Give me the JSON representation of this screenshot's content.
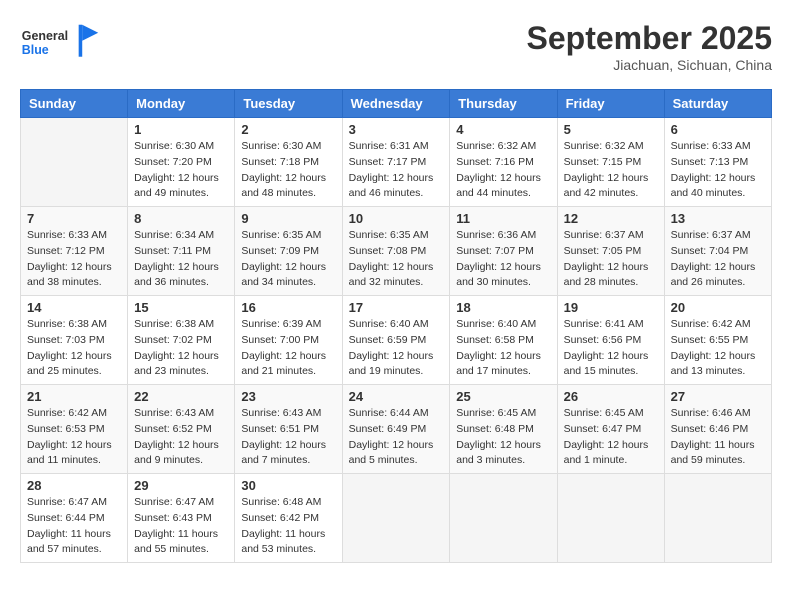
{
  "header": {
    "logo_general": "General",
    "logo_blue": "Blue",
    "month_title": "September 2025",
    "location": "Jiachuan, Sichuan, China"
  },
  "days_of_week": [
    "Sunday",
    "Monday",
    "Tuesday",
    "Wednesday",
    "Thursday",
    "Friday",
    "Saturday"
  ],
  "weeks": [
    [
      {
        "day": "",
        "empty": true
      },
      {
        "day": "1",
        "sunrise": "Sunrise: 6:30 AM",
        "sunset": "Sunset: 7:20 PM",
        "daylight": "Daylight: 12 hours and 49 minutes."
      },
      {
        "day": "2",
        "sunrise": "Sunrise: 6:30 AM",
        "sunset": "Sunset: 7:18 PM",
        "daylight": "Daylight: 12 hours and 48 minutes."
      },
      {
        "day": "3",
        "sunrise": "Sunrise: 6:31 AM",
        "sunset": "Sunset: 7:17 PM",
        "daylight": "Daylight: 12 hours and 46 minutes."
      },
      {
        "day": "4",
        "sunrise": "Sunrise: 6:32 AM",
        "sunset": "Sunset: 7:16 PM",
        "daylight": "Daylight: 12 hours and 44 minutes."
      },
      {
        "day": "5",
        "sunrise": "Sunrise: 6:32 AM",
        "sunset": "Sunset: 7:15 PM",
        "daylight": "Daylight: 12 hours and 42 minutes."
      },
      {
        "day": "6",
        "sunrise": "Sunrise: 6:33 AM",
        "sunset": "Sunset: 7:13 PM",
        "daylight": "Daylight: 12 hours and 40 minutes."
      }
    ],
    [
      {
        "day": "7",
        "sunrise": "Sunrise: 6:33 AM",
        "sunset": "Sunset: 7:12 PM",
        "daylight": "Daylight: 12 hours and 38 minutes."
      },
      {
        "day": "8",
        "sunrise": "Sunrise: 6:34 AM",
        "sunset": "Sunset: 7:11 PM",
        "daylight": "Daylight: 12 hours and 36 minutes."
      },
      {
        "day": "9",
        "sunrise": "Sunrise: 6:35 AM",
        "sunset": "Sunset: 7:09 PM",
        "daylight": "Daylight: 12 hours and 34 minutes."
      },
      {
        "day": "10",
        "sunrise": "Sunrise: 6:35 AM",
        "sunset": "Sunset: 7:08 PM",
        "daylight": "Daylight: 12 hours and 32 minutes."
      },
      {
        "day": "11",
        "sunrise": "Sunrise: 6:36 AM",
        "sunset": "Sunset: 7:07 PM",
        "daylight": "Daylight: 12 hours and 30 minutes."
      },
      {
        "day": "12",
        "sunrise": "Sunrise: 6:37 AM",
        "sunset": "Sunset: 7:05 PM",
        "daylight": "Daylight: 12 hours and 28 minutes."
      },
      {
        "day": "13",
        "sunrise": "Sunrise: 6:37 AM",
        "sunset": "Sunset: 7:04 PM",
        "daylight": "Daylight: 12 hours and 26 minutes."
      }
    ],
    [
      {
        "day": "14",
        "sunrise": "Sunrise: 6:38 AM",
        "sunset": "Sunset: 7:03 PM",
        "daylight": "Daylight: 12 hours and 25 minutes."
      },
      {
        "day": "15",
        "sunrise": "Sunrise: 6:38 AM",
        "sunset": "Sunset: 7:02 PM",
        "daylight": "Daylight: 12 hours and 23 minutes."
      },
      {
        "day": "16",
        "sunrise": "Sunrise: 6:39 AM",
        "sunset": "Sunset: 7:00 PM",
        "daylight": "Daylight: 12 hours and 21 minutes."
      },
      {
        "day": "17",
        "sunrise": "Sunrise: 6:40 AM",
        "sunset": "Sunset: 6:59 PM",
        "daylight": "Daylight: 12 hours and 19 minutes."
      },
      {
        "day": "18",
        "sunrise": "Sunrise: 6:40 AM",
        "sunset": "Sunset: 6:58 PM",
        "daylight": "Daylight: 12 hours and 17 minutes."
      },
      {
        "day": "19",
        "sunrise": "Sunrise: 6:41 AM",
        "sunset": "Sunset: 6:56 PM",
        "daylight": "Daylight: 12 hours and 15 minutes."
      },
      {
        "day": "20",
        "sunrise": "Sunrise: 6:42 AM",
        "sunset": "Sunset: 6:55 PM",
        "daylight": "Daylight: 12 hours and 13 minutes."
      }
    ],
    [
      {
        "day": "21",
        "sunrise": "Sunrise: 6:42 AM",
        "sunset": "Sunset: 6:53 PM",
        "daylight": "Daylight: 12 hours and 11 minutes."
      },
      {
        "day": "22",
        "sunrise": "Sunrise: 6:43 AM",
        "sunset": "Sunset: 6:52 PM",
        "daylight": "Daylight: 12 hours and 9 minutes."
      },
      {
        "day": "23",
        "sunrise": "Sunrise: 6:43 AM",
        "sunset": "Sunset: 6:51 PM",
        "daylight": "Daylight: 12 hours and 7 minutes."
      },
      {
        "day": "24",
        "sunrise": "Sunrise: 6:44 AM",
        "sunset": "Sunset: 6:49 PM",
        "daylight": "Daylight: 12 hours and 5 minutes."
      },
      {
        "day": "25",
        "sunrise": "Sunrise: 6:45 AM",
        "sunset": "Sunset: 6:48 PM",
        "daylight": "Daylight: 12 hours and 3 minutes."
      },
      {
        "day": "26",
        "sunrise": "Sunrise: 6:45 AM",
        "sunset": "Sunset: 6:47 PM",
        "daylight": "Daylight: 12 hours and 1 minute."
      },
      {
        "day": "27",
        "sunrise": "Sunrise: 6:46 AM",
        "sunset": "Sunset: 6:46 PM",
        "daylight": "Daylight: 11 hours and 59 minutes."
      }
    ],
    [
      {
        "day": "28",
        "sunrise": "Sunrise: 6:47 AM",
        "sunset": "Sunset: 6:44 PM",
        "daylight": "Daylight: 11 hours and 57 minutes."
      },
      {
        "day": "29",
        "sunrise": "Sunrise: 6:47 AM",
        "sunset": "Sunset: 6:43 PM",
        "daylight": "Daylight: 11 hours and 55 minutes."
      },
      {
        "day": "30",
        "sunrise": "Sunrise: 6:48 AM",
        "sunset": "Sunset: 6:42 PM",
        "daylight": "Daylight: 11 hours and 53 minutes."
      },
      {
        "day": "",
        "empty": true
      },
      {
        "day": "",
        "empty": true
      },
      {
        "day": "",
        "empty": true
      },
      {
        "day": "",
        "empty": true
      }
    ]
  ]
}
